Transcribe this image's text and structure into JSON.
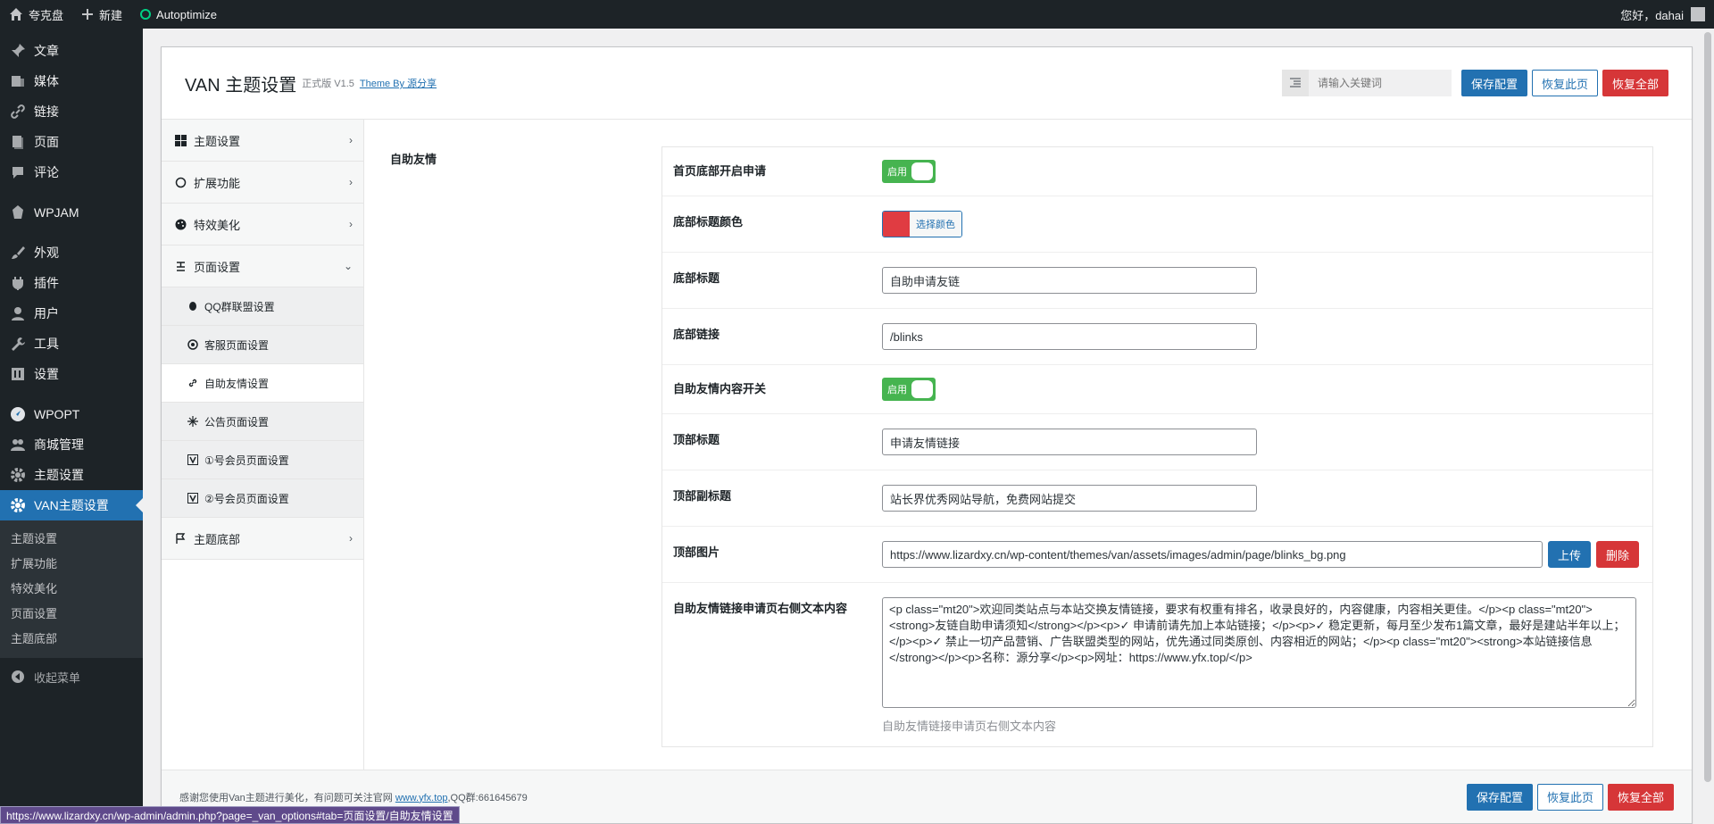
{
  "adminbar": {
    "site": "夸克盘",
    "new": "新建",
    "autoptimize": "Autoptimize",
    "greeting": "您好，dahai"
  },
  "menu": {
    "items": [
      {
        "label": "文章",
        "icon": "pin-icon"
      },
      {
        "label": "媒体",
        "icon": "media-icon"
      },
      {
        "label": "链接",
        "icon": "link-icon"
      },
      {
        "label": "页面",
        "icon": "page-icon"
      },
      {
        "label": "评论",
        "icon": "comment-icon"
      },
      {
        "label": "WPJAM",
        "icon": "wpjam-icon"
      },
      {
        "label": "外观",
        "icon": "brush-icon"
      },
      {
        "label": "插件",
        "icon": "plugin-icon"
      },
      {
        "label": "用户",
        "icon": "user-icon"
      },
      {
        "label": "工具",
        "icon": "wrench-icon"
      },
      {
        "label": "设置",
        "icon": "settings-icon"
      },
      {
        "label": "WPOPT",
        "icon": "rocket-icon"
      },
      {
        "label": "商城管理",
        "icon": "group-icon"
      },
      {
        "label": "主题设置",
        "icon": "gear-icon"
      },
      {
        "label": "VAN主题设置",
        "icon": "gear-icon"
      }
    ],
    "submenu": [
      "主题设置",
      "扩展功能",
      "特效美化",
      "页面设置",
      "主题底部"
    ],
    "collapse": "收起菜单"
  },
  "header": {
    "title": "VAN 主题设置",
    "version": "正式版 V1.5",
    "by": "Theme By 源分享",
    "search_placeholder": "请输入关键词",
    "save": "保存配置",
    "reset_page": "恢复此页",
    "reset_all": "恢复全部"
  },
  "nav": {
    "theme_settings": "主题设置",
    "extensions": "扩展功能",
    "effects": "特效美化",
    "page_settings": "页面设置",
    "subs": [
      "QQ群联盟设置",
      "客服页面设置",
      "自助友情设置",
      "公告页面设置",
      "①号会员页面设置",
      "②号会员页面设置"
    ],
    "footer": "主题底部"
  },
  "content": {
    "section": "自助友情",
    "fields": {
      "f1_label": "首页底部开启申请",
      "toggle_on": "启用",
      "f2_label": "底部标题颜色",
      "color_btn": "选择颜色",
      "color_value": "#e03c42",
      "f3_label": "底部标题",
      "f3_value": "自助申请友链",
      "f4_label": "底部链接",
      "f4_value": "/blinks",
      "f5_label": "自助友情内容开关",
      "f6_label": "顶部标题",
      "f6_value": "申请友情链接",
      "f7_label": "顶部副标题",
      "f7_value": "站长界优秀网站导航，免费网站提交",
      "f8_label": "顶部图片",
      "f8_value": "https://www.lizardxy.cn/wp-content/themes/van/assets/images/admin/page/blinks_bg.png",
      "upload": "上传",
      "delete": "删除",
      "f9_label": "自助友情链接申请页右侧文本内容",
      "f9_value": "<p class=\"mt20\">欢迎同类站点与本站交换友情链接，要求有权重有排名，收录良好的，内容健康，内容相关更佳。</p><p class=\"mt20\"><strong>友链自助申请须知</strong></p><p>✓ 申请前请先加上本站链接；</p><p>✓ 稳定更新，每月至少发布1篇文章，最好是建站半年以上；</p><p>✓ 禁止一切产品营销、广告联盟类型的网站，优先通过同类原创、内容相近的网站；</p><p class=\"mt20\"><strong>本站链接信息</strong></p><p>名称：源分享</p><p>网址：https://www.yfx.top/</p>",
      "f9_help": "自助友情链接申请页右侧文本内容"
    }
  },
  "footer": {
    "text_prefix": "感谢您使用Van主题进行美化，有问题可关注官网 ",
    "link": "www.yfx.top",
    "text_suffix": ",QQ群:661645679"
  },
  "statusbar": "https://www.lizardxy.cn/wp-admin/admin.php?page=_van_options#tab=页面设置/自助友情设置"
}
